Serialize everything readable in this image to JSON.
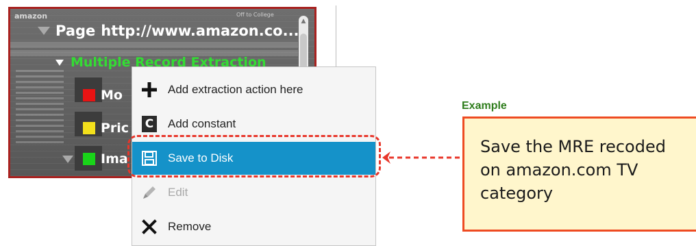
{
  "tree": {
    "page_label": "Page",
    "page_url": "http://www.amazon.co...",
    "mre_label": "Multiple Record Extraction",
    "items": [
      {
        "label": "Mo",
        "color": "#e81313"
      },
      {
        "label": "Pric",
        "color": "#f3e01b"
      },
      {
        "label": "Ima",
        "color": "#19d419"
      }
    ]
  },
  "context_menu": {
    "items": [
      {
        "label": "Add extraction action here",
        "icon": "plus-icon",
        "state": "normal"
      },
      {
        "label": "Add constant",
        "icon": "constant-c-icon",
        "state": "normal"
      },
      {
        "label": "Save to Disk",
        "icon": "floppy-disk-icon",
        "state": "highlighted"
      },
      {
        "label": "Edit",
        "icon": "pencil-icon",
        "state": "disabled"
      },
      {
        "label": "Remove",
        "icon": "x-icon",
        "state": "normal"
      }
    ],
    "constant_icon_letter": "C"
  },
  "annotation": {
    "heading": "Example",
    "text": "Save the MRE recoded\non amazon.com TV\ncategory",
    "accent": "#e8362a",
    "heading_color": "#2e7d1c",
    "callout_bg": "#fff6cc"
  },
  "background_page": {
    "logo": "amazon",
    "promo": "Off to College"
  }
}
